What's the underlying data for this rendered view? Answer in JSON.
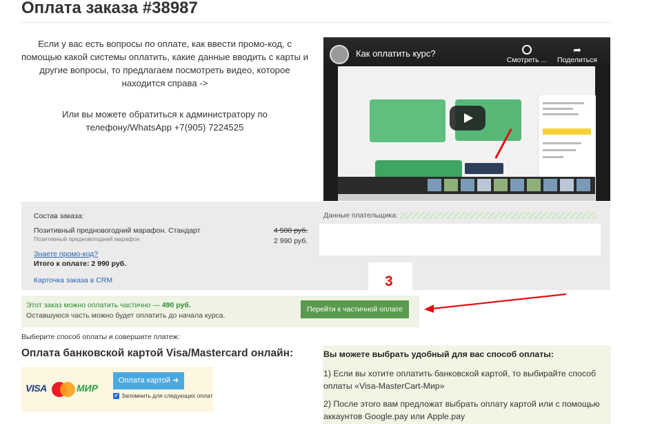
{
  "page": {
    "title": "Оплата заказа #38987"
  },
  "intro": {
    "text": "Если у вас есть вопросы по оплате, как ввести промо-код, с помощью какой системы оплатить, какие данные вводить с карты и другие вопросы, то предлагаем посмотреть видео, которое находится справа ->",
    "contact": "Или вы можете обратиться к администратору по телефону/WhatsApp +7(905) 7224525"
  },
  "video": {
    "title": "Как оплатить курс?",
    "watch_later": "Смотреть ...",
    "share": "Поделиться"
  },
  "order": {
    "composition_label": "Состав заказа:",
    "item_name": "Позитивный предновогодний марафон. Стандарт",
    "item_sub": "Позитивный предновогодний марафон",
    "old_price": "4 500 руб.",
    "new_price": "2 990 руб.",
    "promo_link": "Знаете промо-код?",
    "total": "Итого к оплате: 2 990 руб.",
    "crm_link": "Карточка заказа в CRM",
    "payer_label": "Данные плательщика:"
  },
  "annotation": {
    "number": "3",
    "color": "#e01010"
  },
  "partial": {
    "line1_prefix": "Этот заказ можно оплатить частично — ",
    "line1_amount": "490 руб.",
    "line2": "Оставшуюся часть можно будет оплатить до начала курса.",
    "button": "Перейти к частичной оплате"
  },
  "payment": {
    "choose_text": "Выберите способ оплаты и совершите платеж:",
    "card_title": "Оплата банковской картой Visa/Mastercard онлайн:",
    "logo_visa": "VISA",
    "logo_mir": "МИР",
    "pay_button": "Оплата картой ➜",
    "remember_label": "Запомнить для следующих оплат",
    "remember_checked": true
  },
  "info": {
    "heading": "Вы можете выбрать удобный для вас способ оплаты:",
    "p1": "1) Если вы хотите оплатить банковской картой, то выбирайте способ оплаты «Visa-MasterCart-Мир»",
    "p2": "2) После этого вам предложат выбрать оплату картой или с помощью аккаунтов Google.pay или Apple.pay"
  },
  "colors": {
    "accent_green": "#5b9a4e",
    "pay_blue": "#4aa9e0",
    "link_blue": "#2a64b5"
  }
}
